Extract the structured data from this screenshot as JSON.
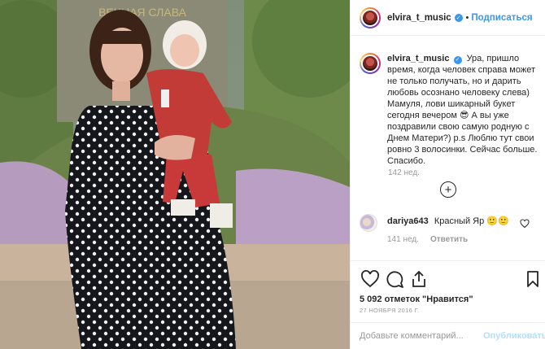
{
  "header": {
    "username": "elvira_t_music",
    "separator": "•",
    "follow_label": "Подписаться"
  },
  "caption": {
    "username": "elvira_t_music",
    "text": "Ура, пришло время, когда человек справа может не только получать, но и дарить любовь осознано человеку слева) Мамуля, лови шикарный букет сегодня вечером 😎 А вы уже поздравили свою самую родную с Днем Матери?) p.s Люблю тут свои ровно 3 волосинки. Сейчас больше. Спасибо.",
    "time": "142 нед."
  },
  "comment": {
    "username": "dariya643",
    "text": "Красный Яр 🙂🙂",
    "time": "141 нед.",
    "reply_label": "Ответить"
  },
  "actions": {
    "icons": [
      "heart-icon",
      "comment-icon",
      "share-icon",
      "bookmark-icon"
    ],
    "likes_text": "5 092 отметок \"Нравится\"",
    "date_text": "27 НОЯБРЯ 2016 Г."
  },
  "comment_box": {
    "placeholder": "Добавьте комментарий...",
    "publish_label": "Опубликовать"
  },
  "colors": {
    "accent": "#3897f0",
    "muted": "#999999",
    "text": "#262626",
    "border": "#efefef"
  }
}
